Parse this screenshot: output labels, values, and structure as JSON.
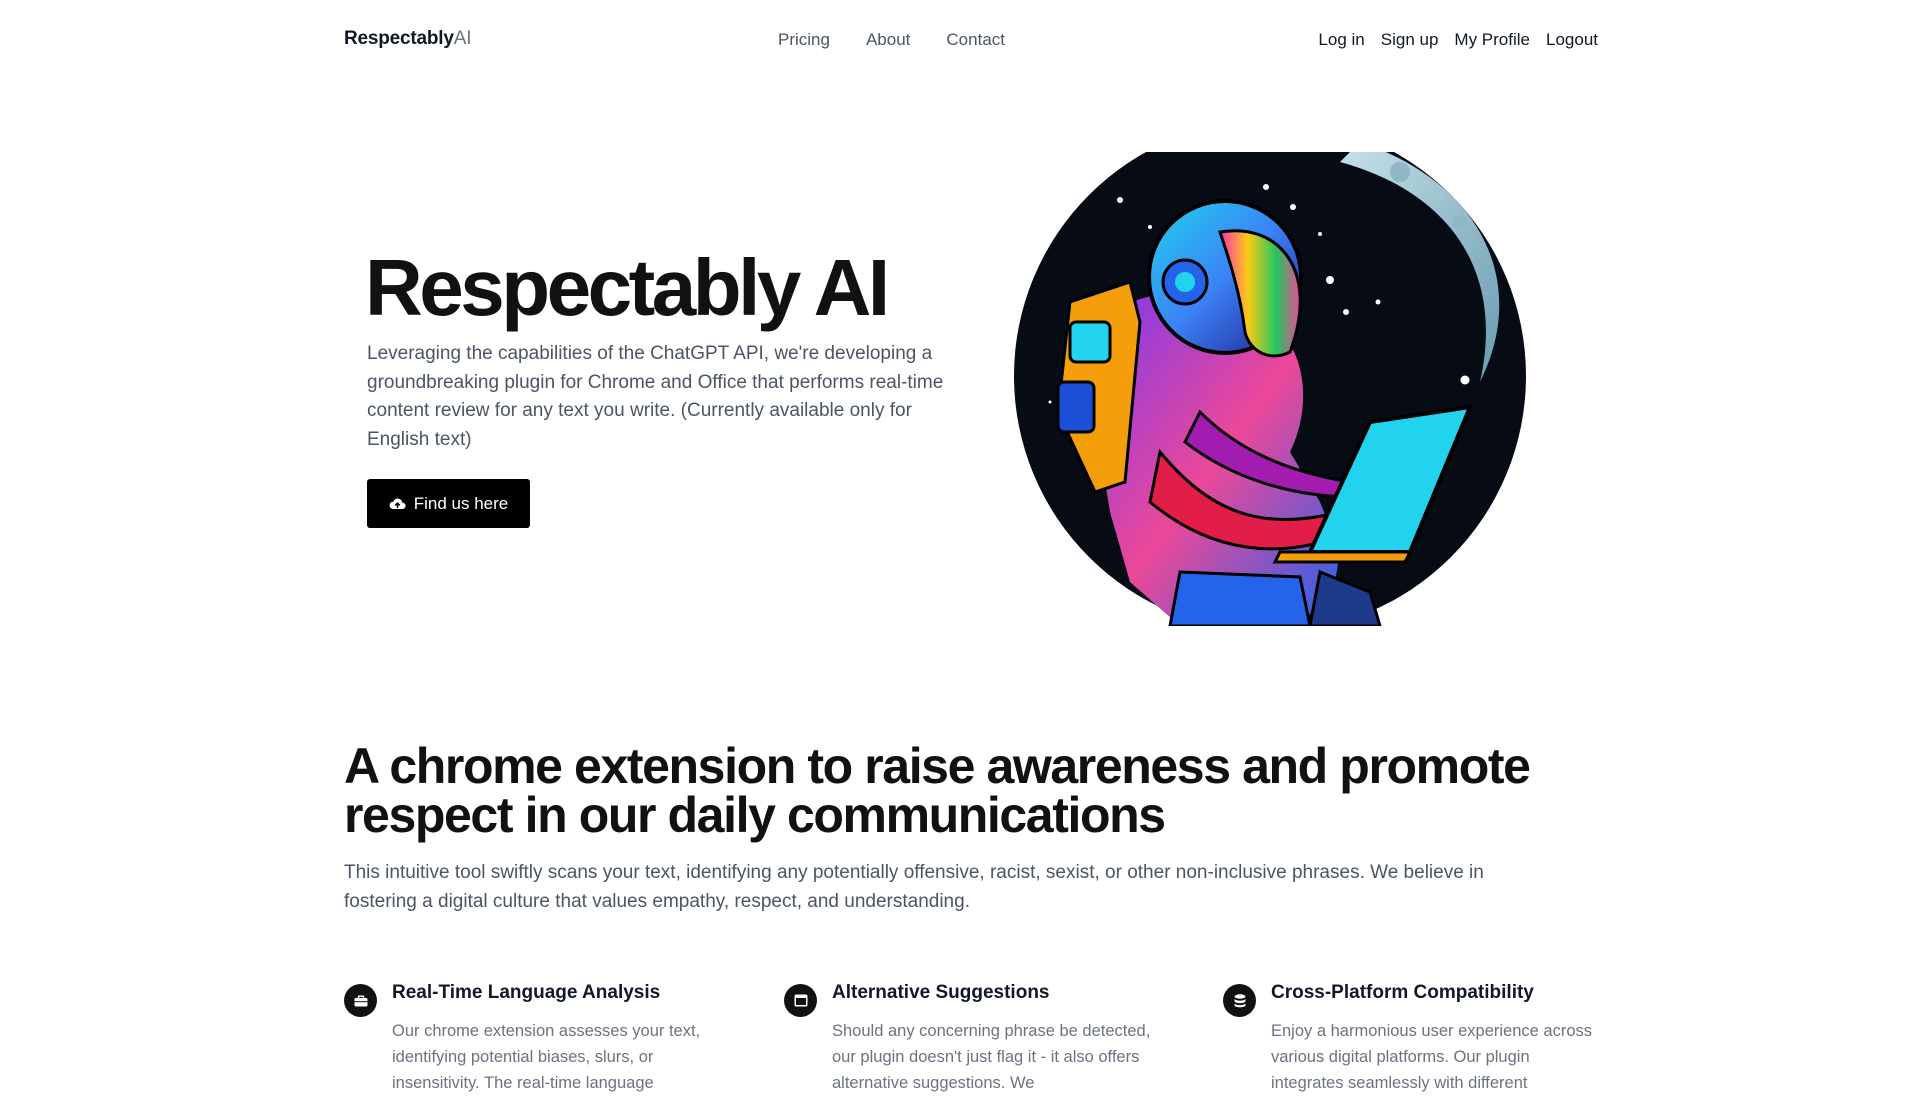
{
  "nav": {
    "brand_bold": "Respectably",
    "brand_light": "AI",
    "links": [
      "Pricing",
      "About",
      "Contact"
    ],
    "auth": [
      "Log in",
      "Sign up",
      "My Profile",
      "Logout"
    ]
  },
  "hero": {
    "title": "Respectably AI",
    "description": "Leveraging the capabilities of the ChatGPT API, we're developing a groundbreaking plugin for Chrome and Office that performs real-time content review for any text you write. (Currently available only for English text)",
    "cta_label": "Find us here",
    "cta_icon": "cloud-upload-icon",
    "image_subject": "astronaut-with-laptop-illustration"
  },
  "section": {
    "title": "A chrome extension to raise awareness and promote respect in our daily communications",
    "description": "This intuitive tool swiftly scans your text, identifying any potentially offensive, racist, sexist, or other non-inclusive phrases. We believe in fostering a digital culture that values empathy, respect, and understanding."
  },
  "features": [
    {
      "icon": "briefcase-icon",
      "title": "Real-Time Language Analysis",
      "text": "Our chrome extension assesses your text, identifying potential biases, slurs, or insensitivity. The real-time language"
    },
    {
      "icon": "browser-window-icon",
      "title": "Alternative Suggestions",
      "text": "Should any concerning phrase be detected, our plugin doesn't just flag it - it also offers alternative suggestions. We"
    },
    {
      "icon": "database-icon",
      "title": "Cross-Platform Compatibility",
      "text": "Enjoy a harmonious user experience across various digital platforms. Our plugin integrates seamlessly with different"
    }
  ],
  "colors": {
    "text_primary": "#111827",
    "text_muted": "#4b5563",
    "button_bg": "#000000"
  }
}
